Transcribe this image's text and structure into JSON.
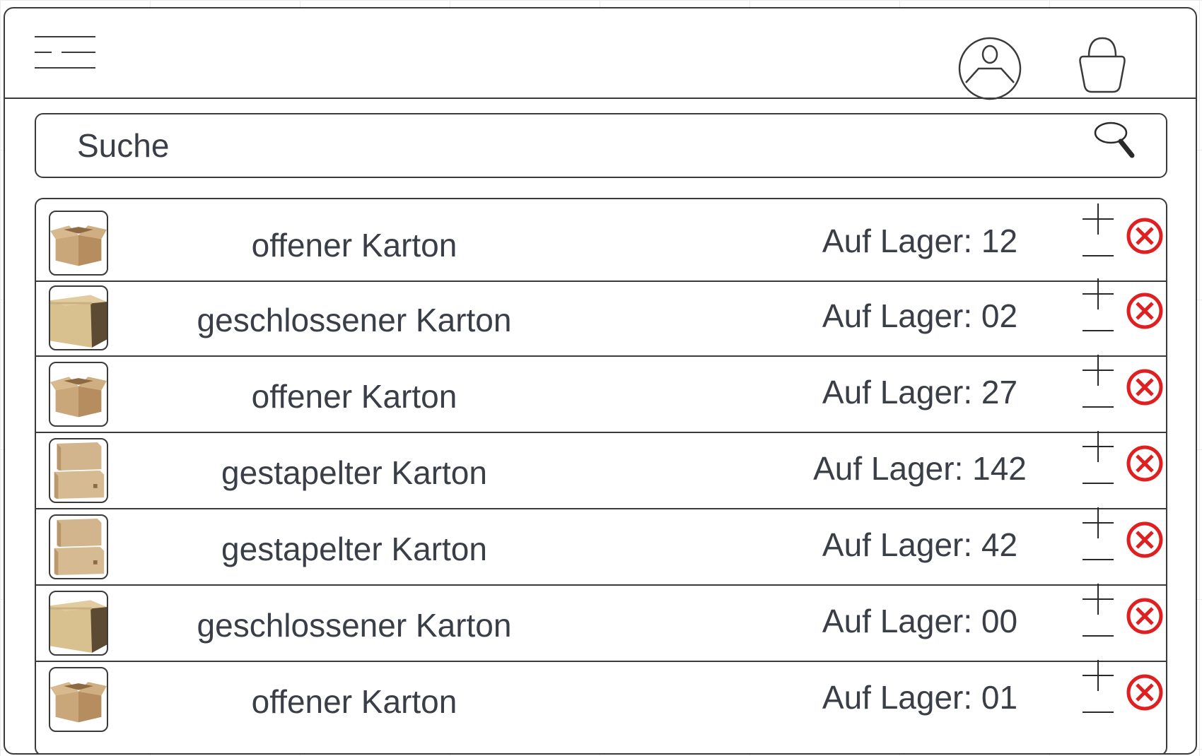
{
  "search": {
    "placeholder": "Suche"
  },
  "icons": {
    "menu": "hamburger-menu-icon",
    "account": "user-account-icon",
    "cart": "shopping-bag-icon",
    "search": "magnifier-icon",
    "increase": "plus-icon",
    "decrease": "minus-icon",
    "remove": "remove-circle-icon"
  },
  "colors": {
    "remove": "#e02020",
    "border": "#3a3a3a",
    "text": "#3a3f47"
  },
  "items": [
    {
      "name": "offener Karton",
      "stock": "Auf Lager: 12",
      "box": "open"
    },
    {
      "name": "geschlossener Karton",
      "stock": "Auf Lager: 02",
      "box": "closed"
    },
    {
      "name": "offener Karton",
      "stock": "Auf Lager: 27",
      "box": "open"
    },
    {
      "name": "gestapelter Karton",
      "stock": "Auf Lager: 142",
      "box": "stacked"
    },
    {
      "name": "gestapelter Karton",
      "stock": "Auf Lager: 42",
      "box": "stacked"
    },
    {
      "name": "geschlossener Karton",
      "stock": "Auf Lager: 00",
      "box": "closed"
    },
    {
      "name": "offener Karton",
      "stock": "Auf Lager: 01",
      "box": "open"
    }
  ]
}
